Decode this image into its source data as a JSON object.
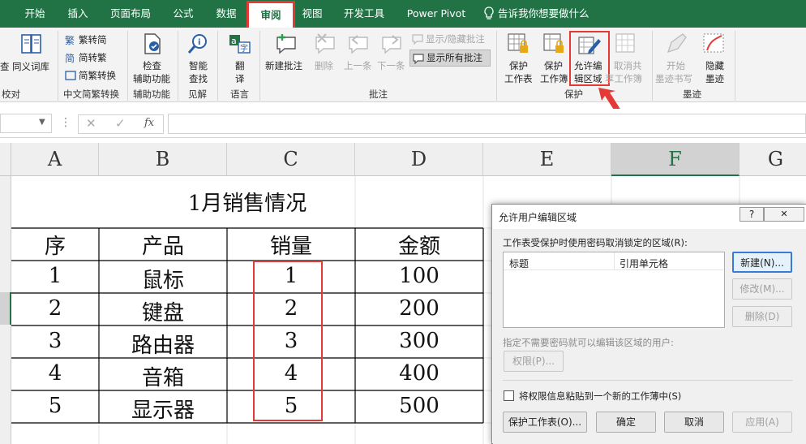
{
  "tabs": [
    "开始",
    "插入",
    "页面布局",
    "公式",
    "数据",
    "审阅",
    "视图",
    "开发工具",
    "Power Pivot",
    "告诉我你想要做什么"
  ],
  "ribbon": {
    "proof": {
      "cut": "查",
      "thes": "同义词库",
      "group": "校对"
    },
    "chinese": {
      "t2s": "繁转简",
      "s2t": "简转繁",
      "conv": "简繁转换",
      "group": "中文简繁转换"
    },
    "access": {
      "l1": "检查",
      "l2": "辅助功能",
      "group": "辅助功能"
    },
    "insight": {
      "l1": "智能",
      "l2": "查找",
      "group": "见解"
    },
    "lang": {
      "l1": "翻",
      "l2": "译",
      "group": "语言"
    },
    "comments": {
      "new": "新建批注",
      "del": "删除",
      "prev": "上一条",
      "next": "下一条",
      "showhide": "显示/隐藏批注",
      "showall": "显示所有批注",
      "group": "批注"
    },
    "protect": {
      "ps1": "保护",
      "ps2": "工作表",
      "pw1": "保护",
      "pw2": "工作簿",
      "ae1": "允许编",
      "ae2": "辑区域",
      "un1": "取消共",
      "un2": "享工作簿",
      "group": "保护"
    },
    "ink": {
      "s1": "开始",
      "s2": "墨迹书写",
      "h1": "隐藏",
      "h2": "墨迹",
      "group": "墨迹"
    }
  },
  "formula_bar": {
    "fx": "fx",
    "value": ""
  },
  "columns": [
    "A",
    "B",
    "C",
    "D",
    "E",
    "F",
    "G"
  ],
  "sheet": {
    "title": "1月销售情况",
    "headers": [
      "序",
      "产品",
      "销量",
      "金额"
    ],
    "rows": [
      [
        "1",
        "鼠标",
        "1",
        "100"
      ],
      [
        "2",
        "键盘",
        "2",
        "200"
      ],
      [
        "3",
        "路由器",
        "3",
        "300"
      ],
      [
        "4",
        "音箱",
        "4",
        "400"
      ],
      [
        "5",
        "显示器",
        "5",
        "500"
      ]
    ]
  },
  "dialog": {
    "title": "允许用户编辑区域",
    "help": "?",
    "close": "✕",
    "desc": "工作表受保护时使用密码取消锁定的区域(R):",
    "col_title": "标题",
    "col_ref": "引用单元格",
    "btn_new": "新建(N)...",
    "btn_modify": "修改(M)...",
    "btn_delete": "删除(D)",
    "perm_desc": "指定不需要密码就可以编辑该区域的用户:",
    "btn_perm": "权限(P)...",
    "checkbox": "将权限信息粘贴到一个新的工作薄中(S)",
    "btn_protect": "保护工作表(O)...",
    "btn_ok": "确定",
    "btn_cancel": "取消",
    "btn_apply": "应用(A)"
  }
}
